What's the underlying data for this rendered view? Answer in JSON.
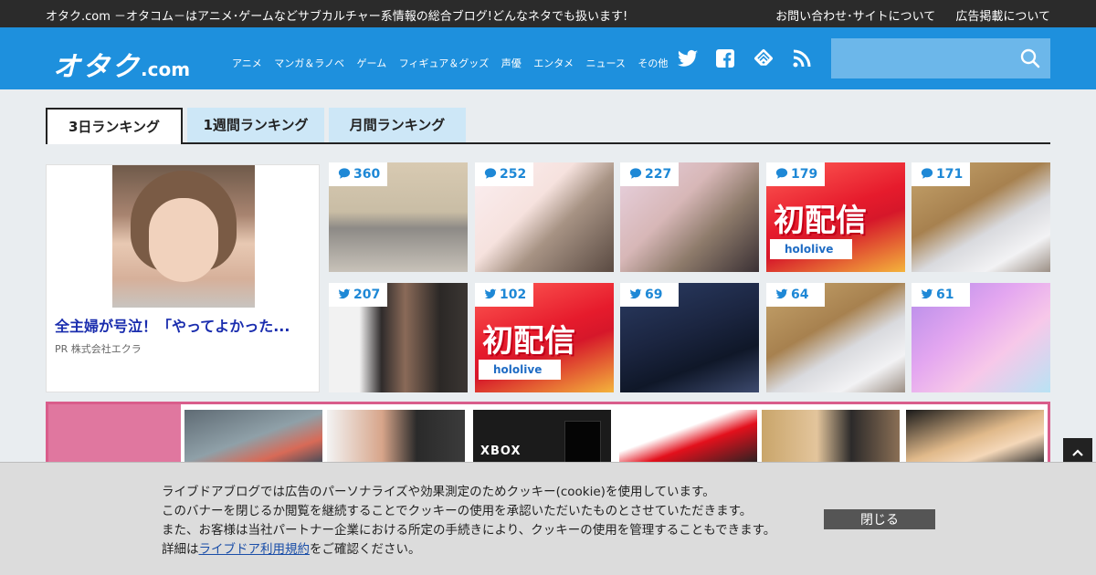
{
  "topbar": {
    "tagline": "オタク.com －オタコム－はアニメ･ゲームなどサブカルチャー系情報の総合ブログ!どんなネタでも扱います!",
    "links": [
      "お問い合わせ･サイトについて",
      "広告掲載について"
    ]
  },
  "header": {
    "logo_kana": "オタク",
    "logo_domain": ".com",
    "nav": [
      "アニメ",
      "マンガ＆ラノベ",
      "ゲーム",
      "フィギュア＆グッズ",
      "声優",
      "エンタメ",
      "ニュース",
      "その他"
    ],
    "social_icons": [
      "twitter-icon",
      "facebook-icon",
      "feedly-icon",
      "rss-icon"
    ],
    "search_placeholder": "",
    "colors": {
      "brand_blue": "#1e90dd",
      "search_bg": "#6cb7ea"
    }
  },
  "tabs": [
    {
      "label": "3日ランキング",
      "active": true
    },
    {
      "label": "1週間ランキング",
      "active": false
    },
    {
      "label": "月間ランキング",
      "active": false
    }
  ],
  "feature": {
    "headline": "全主婦が号泣！「やってよかった...",
    "pr": "PR 株式会社エクラ"
  },
  "ranking": [
    {
      "count": "360",
      "icon": "comment-icon"
    },
    {
      "count": "252",
      "icon": "comment-icon"
    },
    {
      "count": "227",
      "icon": "comment-icon"
    },
    {
      "count": "179",
      "icon": "comment-icon"
    },
    {
      "count": "171",
      "icon": "comment-icon"
    },
    {
      "count": "207",
      "icon": "twitter-icon"
    },
    {
      "count": "102",
      "icon": "twitter-icon"
    },
    {
      "count": "69",
      "icon": "twitter-icon"
    },
    {
      "count": "64",
      "icon": "twitter-icon"
    },
    {
      "count": "61",
      "icon": "twitter-icon"
    }
  ],
  "thumb_text": {
    "hololive_title": "初配信",
    "hololive_logo": "hololive",
    "xbox": "XBOX"
  },
  "cookie": {
    "line1": "ライブドアブログでは広告のパーソナライズや効果測定のためクッキー(cookie)を使用しています。",
    "line2": "このバナーを閉じるか閲覧を継続することでクッキーの使用を承認いただいたものとさせていただきます。",
    "line3": "また、お客様は当社パートナー企業における所定の手続きにより、クッキーの使用を管理することもできます。",
    "line4_prefix": "詳細は",
    "line4_link": "ライブドア利用規約",
    "line4_suffix": "をご確認ください。",
    "close_label": "閉じる"
  }
}
